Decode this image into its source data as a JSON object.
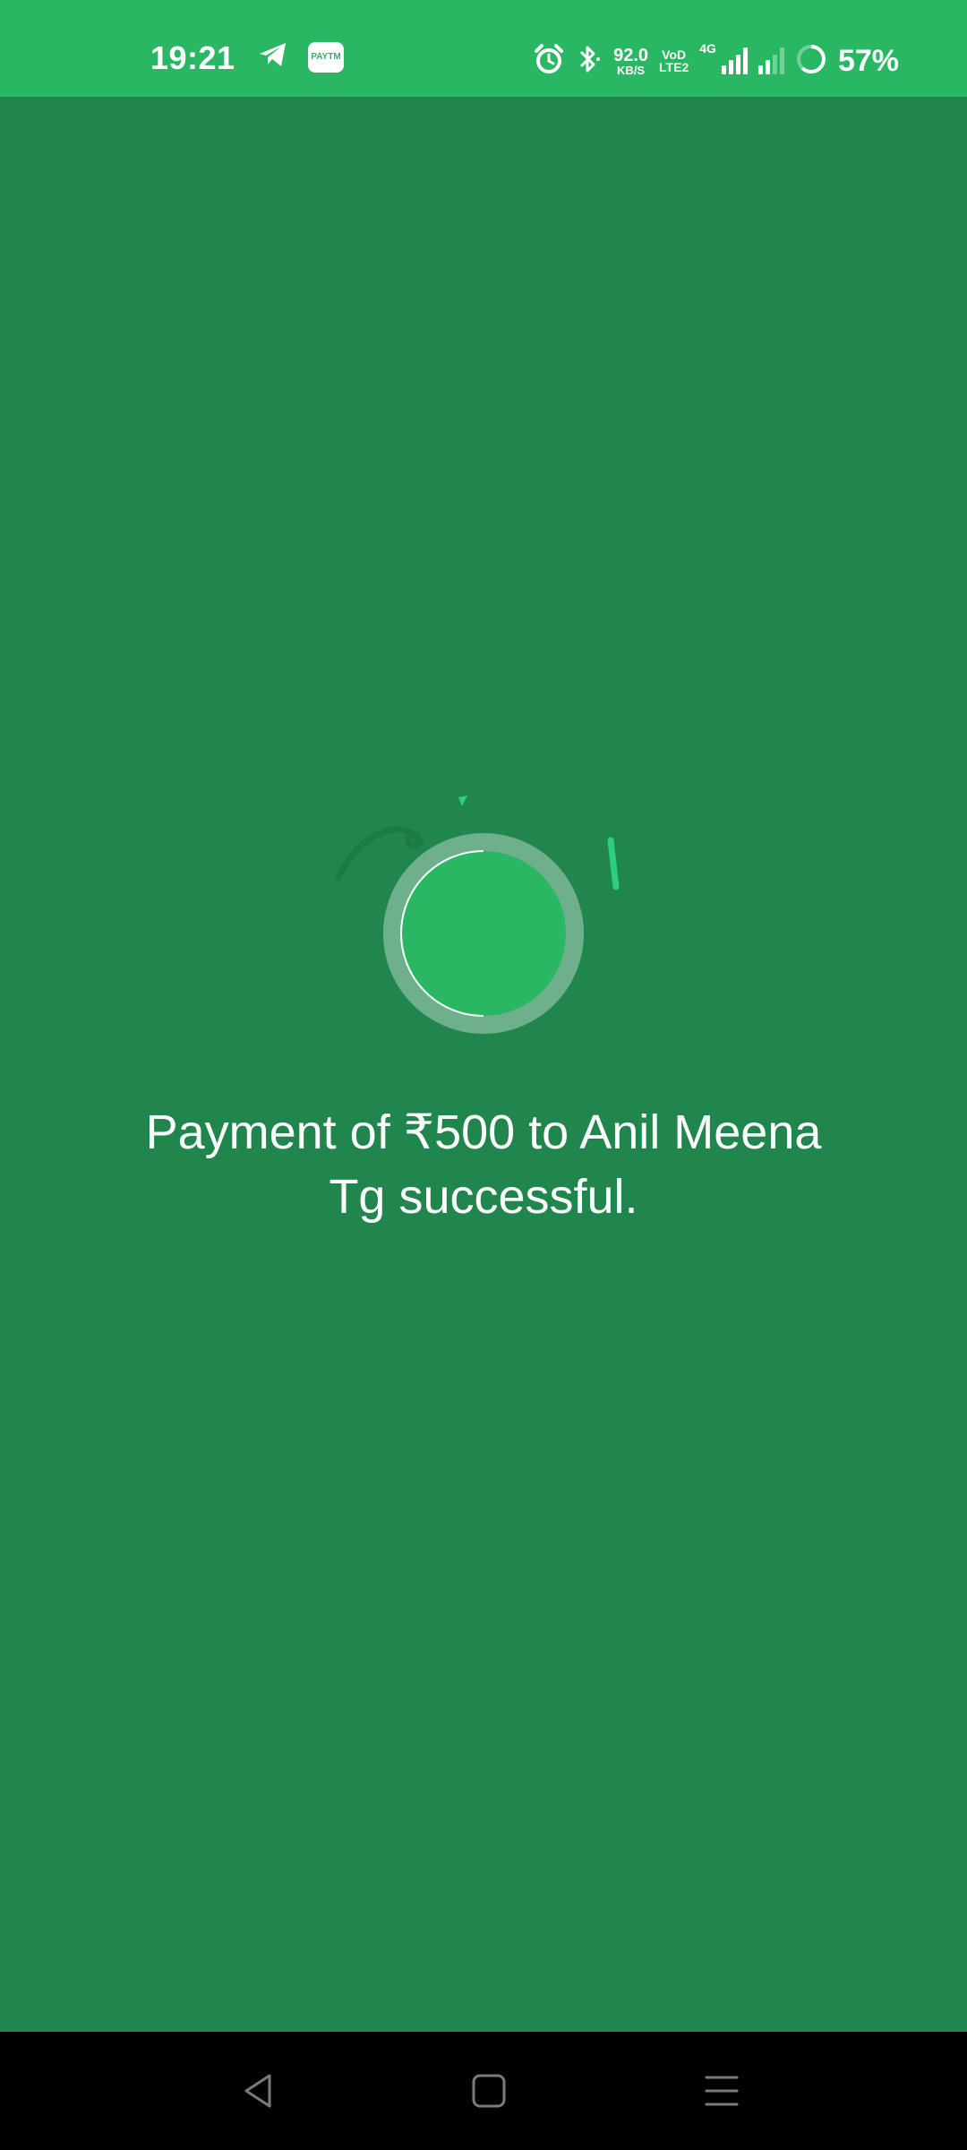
{
  "status_bar": {
    "time": "19:21",
    "net_speed_value": "92.0",
    "net_speed_unit": "KB/S",
    "volte_top": "VoD",
    "volte_bottom": "LTE2",
    "network_type": "4G",
    "battery_percent": "57%",
    "icons": [
      "telegram-icon",
      "paytm-icon",
      "alarm-icon",
      "bluetooth-icon",
      "signal-icon",
      "battery-icon"
    ]
  },
  "paytm_label": "PAYTM",
  "message": {
    "line1": "Payment of ₹500 to Anil Meena",
    "line2": "Tg successful."
  },
  "nav_bar": {
    "icons": [
      "back-icon",
      "home-icon",
      "recents-icon"
    ]
  },
  "colors": {
    "background": "#21864d",
    "status_bar": "#2ab764",
    "circle": "#2ab764"
  }
}
